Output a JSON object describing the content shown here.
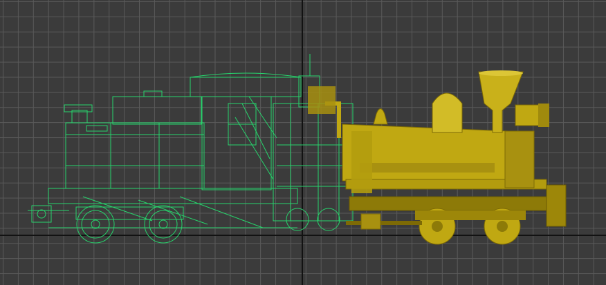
{
  "viewport": {
    "background_color": "#3b3b3b",
    "grid_color": "#5a5a5a",
    "axis_color": "#121212",
    "wireframe_color": "#27d46c",
    "shaded_color": "#c0a812",
    "shaded_dark": "#7d6a05",
    "shaded_light": "#dcc636"
  }
}
